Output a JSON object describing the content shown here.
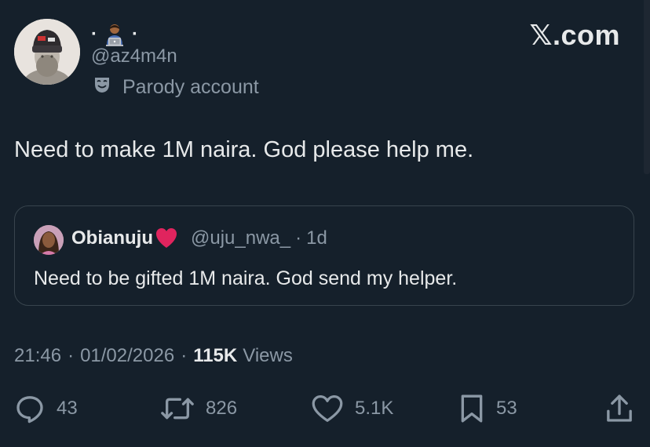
{
  "post": {
    "display_name_dots": [
      "·",
      "·"
    ],
    "display_emoji": "technologist-emoji-icon",
    "handle": "@az4m4n",
    "parody_label": "Parody account",
    "text": "Need to make 1M naira. God please help me."
  },
  "branding": {
    "logo": "𝕏.com"
  },
  "quote": {
    "name": "Obianuju",
    "name_emoji": "red-heart-icon",
    "handle": "@uju_nwa_",
    "separator": "·",
    "time": "1d",
    "text": "Need to be gifted 1M naira. God send my helper."
  },
  "meta": {
    "time": "21:46",
    "separator": "·",
    "date": "01/02/2026",
    "views_count": "115K",
    "views_label": "Views"
  },
  "actions": {
    "replies": "43",
    "reposts": "826",
    "likes": "5.1K",
    "bookmarks": "53"
  },
  "colors": {
    "background": "#15202b",
    "text_primary": "#e7e9ea",
    "text_secondary": "#8b98a5",
    "border": "#38444d",
    "heart": "#e0245e"
  }
}
